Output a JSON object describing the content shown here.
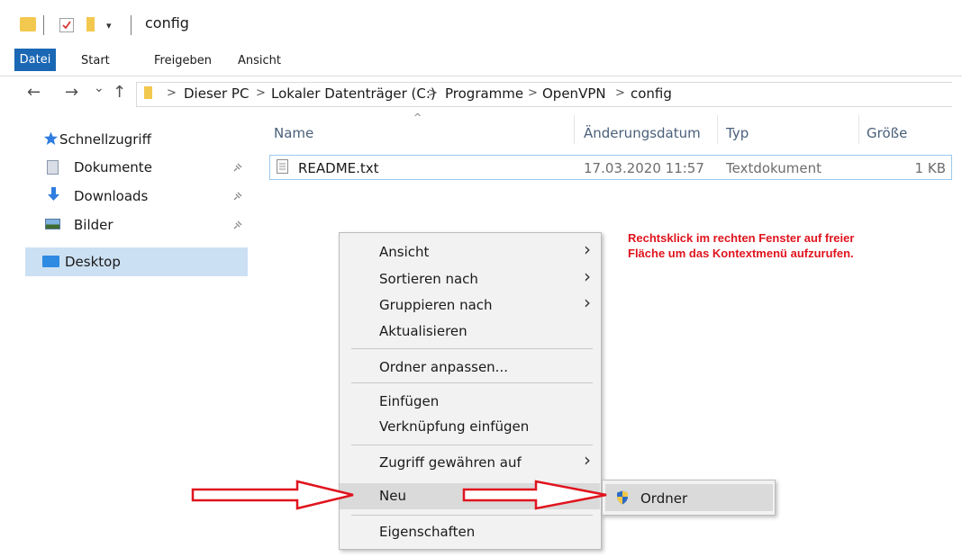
{
  "window": {
    "title": "config",
    "quick_access_dropdown": "▾"
  },
  "ribbon": {
    "tabs": [
      "Datei",
      "Start",
      "Freigeben",
      "Ansicht"
    ]
  },
  "nav": {
    "back": "←",
    "forward": "→",
    "recent": "⌄",
    "up": "↑",
    "breadcrumbs": [
      "Dieser PC",
      "Lokaler Datenträger (C:)",
      "Programme",
      "OpenVPN",
      "config"
    ],
    "separator": ">"
  },
  "sidebar": {
    "items": [
      {
        "label": "Schnellzugriff",
        "icon": "star-icon"
      },
      {
        "label": "Dokumente",
        "icon": "documents-icon",
        "pinned": true
      },
      {
        "label": "Downloads",
        "icon": "download-arrow-icon",
        "pinned": true
      },
      {
        "label": "Bilder",
        "icon": "pictures-icon",
        "pinned": true
      },
      {
        "label": "Desktop",
        "icon": "desktop-icon",
        "selected": true
      }
    ],
    "pin_glyph": "📌"
  },
  "file_list": {
    "sort_indicator": "^",
    "columns": [
      "Name",
      "Änderungsdatum",
      "Typ",
      "Größe"
    ],
    "rows": [
      {
        "name": "README.txt",
        "date": "17.03.2020 11:57",
        "type": "Textdokument",
        "size": "1 KB",
        "icon": "text-file-icon"
      }
    ]
  },
  "annotation": {
    "line1": "Rechtsklick im rechten Fenster auf freier",
    "line2": "Fläche um das Kontextmenü aufzurufen.",
    "color": "#e0141e"
  },
  "context_menu": {
    "items": [
      {
        "label": "Ansicht",
        "submenu": true
      },
      {
        "label": "Sortieren nach",
        "submenu": true
      },
      {
        "label": "Gruppieren nach",
        "submenu": true
      },
      {
        "label": "Aktualisieren"
      },
      {
        "label": "Ordner anpassen..."
      },
      {
        "label": "Einfügen"
      },
      {
        "label": "Verknüpfung einfügen"
      },
      {
        "label": "Zugriff gewähren auf",
        "submenu": true
      },
      {
        "label": "Neu",
        "submenu": true,
        "highlighted": true
      },
      {
        "label": "Eigenschaften"
      }
    ],
    "chevron": "›"
  },
  "submenu": {
    "items": [
      {
        "label": "Ordner",
        "icon": "shield-icon",
        "highlighted": true
      }
    ]
  },
  "colors": {
    "accent": "#1a67b4",
    "selection": "#cce0f3",
    "arrow": "#e0141e",
    "folder": "#f3c84f"
  }
}
